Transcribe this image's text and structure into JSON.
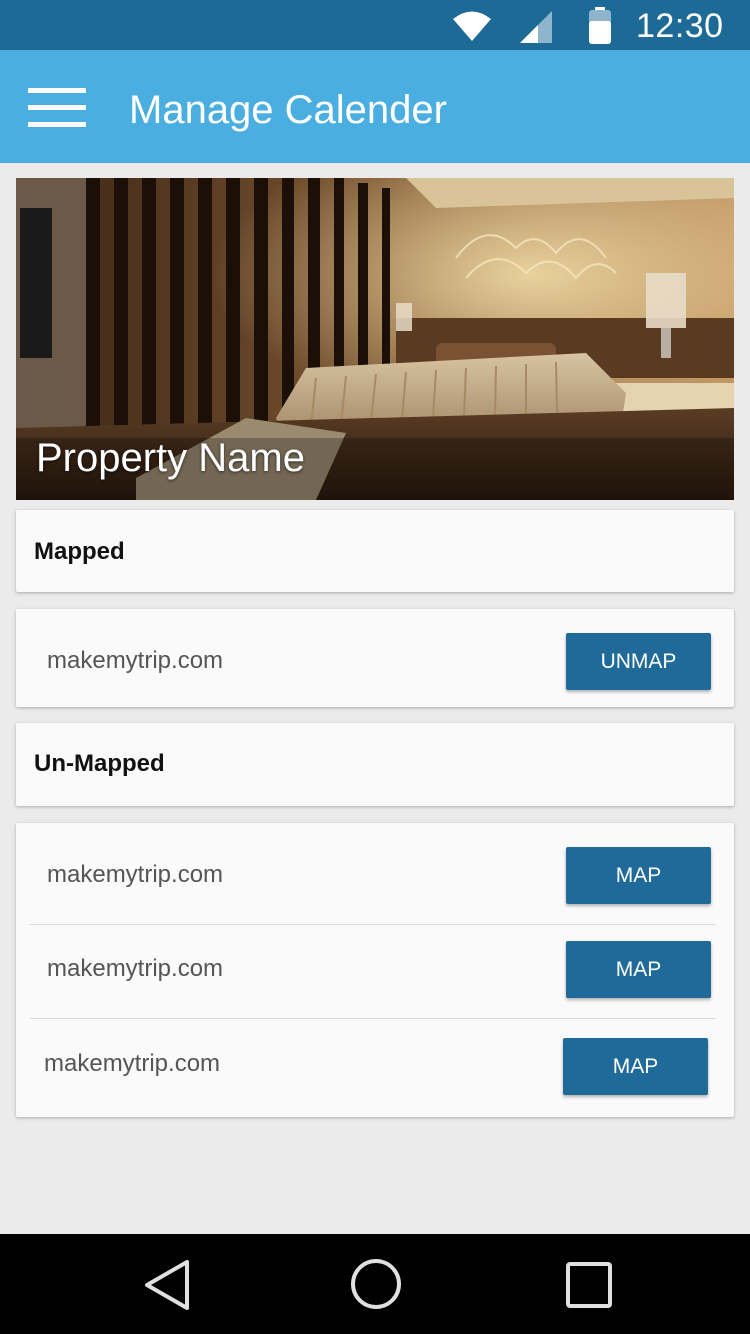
{
  "status_bar": {
    "time": "12:30"
  },
  "app_bar": {
    "title": "Manage Calender"
  },
  "property": {
    "name": "Property Name"
  },
  "mapped_section": {
    "title": "Mapped",
    "items": [
      {
        "site": "makemytrip.com",
        "action": "UNMAP"
      }
    ]
  },
  "unmapped_section": {
    "title": "Un-Mapped",
    "items": [
      {
        "site": "makemytrip.com",
        "action": "MAP"
      },
      {
        "site": "makemytrip.com",
        "action": "MAP"
      },
      {
        "site": "makemytrip.com",
        "action": "MAP"
      }
    ]
  },
  "icons": {
    "menu": "hamburger-menu-icon",
    "wifi": "wifi-icon",
    "signal": "cell-signal-icon",
    "battery": "battery-icon",
    "back": "back-triangle-icon",
    "home": "home-circle-icon",
    "recents": "recents-square-icon"
  },
  "colors": {
    "status_bar": "#1d6a96",
    "app_bar": "#4aaee1",
    "button": "#1f6a99",
    "background": "#ebebeb"
  }
}
